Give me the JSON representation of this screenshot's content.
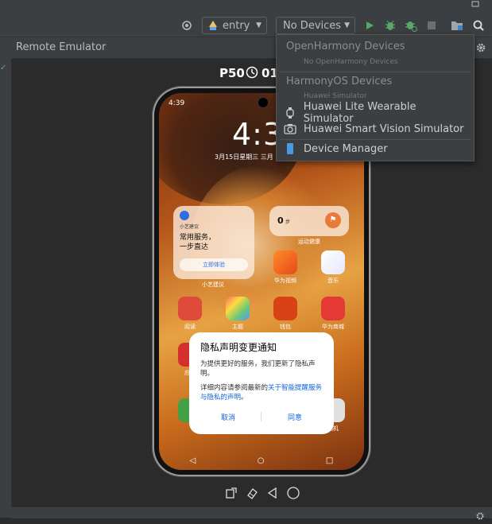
{
  "toolbar": {
    "config_combo": "entry",
    "device_combo": "No Devices",
    "colors": {
      "run": "#59a869",
      "debug": "#59a869",
      "stop": "#6e6e6e"
    }
  },
  "panel": {
    "title": "Remote Emulator"
  },
  "emulator": {
    "device_name": "P50",
    "clock_prefix": "01:"
  },
  "phone": {
    "status_time": "4:39",
    "lock_clock": "4:3",
    "date_text": "3月15日星期三 三月",
    "widget_tip_small": "小艺建议",
    "widget_tip_line1": "常用服务，",
    "widget_tip_line2": "一步直达",
    "widget_tip_button": "立即体验",
    "widget_tip_label": "小艺建议",
    "widget_steps_value": "0",
    "widget_steps_unit": "步",
    "widget_steps_label": "运动健康",
    "apps": [
      {
        "label": "华为视频"
      },
      {
        "label": "音乐"
      },
      {
        "label": "阅读"
      },
      {
        "label": "主题"
      },
      {
        "label": "钱包"
      },
      {
        "label": "华为商城"
      },
      {
        "label": "应用"
      },
      {
        "label": "相机"
      }
    ]
  },
  "dialog": {
    "title": "隐私声明变更通知",
    "body1": "为提供更好的服务，我们更新了隐私声明。",
    "body2_prefix": "详细内容请参阅最新的",
    "body2_link": "关于智能提醒服务与隐私的声明",
    "body2_suffix": "。",
    "cancel": "取消",
    "agree": "同意"
  },
  "dropdown": {
    "group1": "OpenHarmony Devices",
    "group1_empty": "No OpenHarmony Devices",
    "group2": "HarmonyOS Devices",
    "group2_sub": "Huawei Simulator",
    "items": [
      {
        "label": "Huawei Lite Wearable Simulator",
        "icon": "watch-icon"
      },
      {
        "label": "Huawei Smart Vision Simulator",
        "icon": "camera-icon"
      }
    ],
    "device_manager": "Device Manager"
  }
}
